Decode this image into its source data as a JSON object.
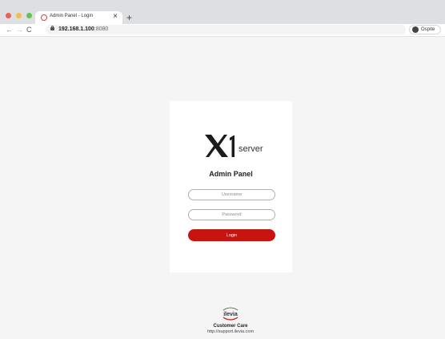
{
  "browser": {
    "tab": {
      "title": "Admin Panel - Login",
      "close_glyph": "×"
    },
    "new_tab_glyph": "+",
    "nav": {
      "back": "←",
      "forward": "→",
      "reload": "C"
    },
    "address": {
      "host": "192.168.1.100",
      "port": ":8080"
    },
    "profile": {
      "label": "Ospite",
      "icon": "person-circle-icon"
    },
    "traffic_colors": {
      "close": "#ec5f56",
      "minimize": "#f4be4f",
      "maximize": "#61c454"
    }
  },
  "login": {
    "logo": {
      "mark": "X1",
      "product": "server"
    },
    "title": "Admin Panel",
    "username_placeholder": "Username",
    "password_placeholder": "Password",
    "login_label": "Login",
    "accent_color": "#c8130f"
  },
  "footer": {
    "brand": "ilevia",
    "title": "Customer Care",
    "link": "http://support.ilevia.com"
  }
}
